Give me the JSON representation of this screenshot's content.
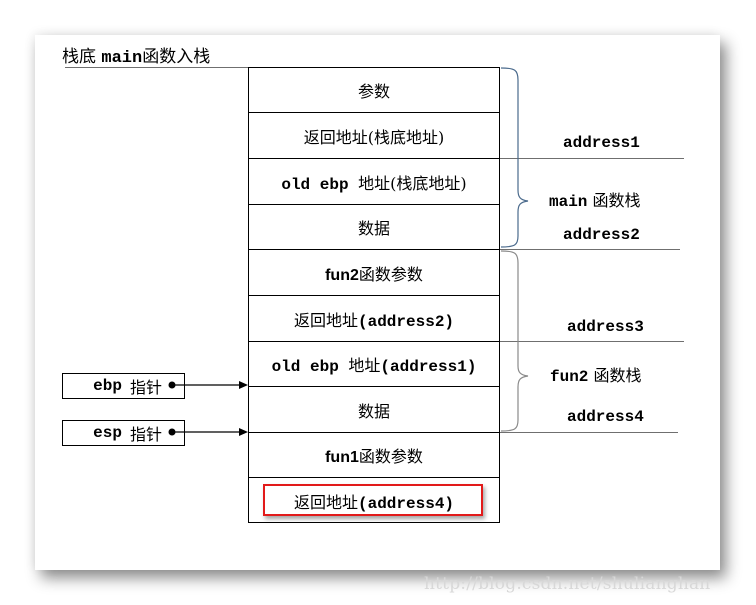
{
  "title": {
    "prefix": "栈底 ",
    "code": "main",
    "suffix": "函数入栈"
  },
  "stack_rows": [
    {
      "text": "参数",
      "code": ""
    },
    {
      "text": "返回地址(栈底地址)",
      "code": ""
    },
    {
      "code_prefix": "old ebp ",
      "text": "地址(栈底地址)"
    },
    {
      "text": "数据",
      "code": ""
    },
    {
      "code_prefix": "fun2",
      "text": "函数参数"
    },
    {
      "text": "返回地址",
      "code_suffix": "(address2)"
    },
    {
      "code_prefix": "old ebp ",
      "text": "地址",
      "code_suffix": "(address1)"
    },
    {
      "text": "数据",
      "code": ""
    },
    {
      "code_prefix": "fun1",
      "text": "函数参数"
    },
    {
      "text": "返回地址",
      "code_suffix": "(address4)",
      "highlighted": true
    }
  ],
  "addresses": [
    {
      "label": "address1"
    },
    {
      "label": "address2"
    },
    {
      "label": "address3"
    },
    {
      "label": "address4"
    }
  ],
  "braces": [
    {
      "code": "main",
      "text": " 函数栈",
      "color": "#4a6a8c"
    },
    {
      "code": "fun2",
      "text": " 函数栈",
      "color": "#8a8a8a"
    }
  ],
  "pointers": [
    {
      "code": "ebp",
      "text": "指针",
      "points_to": "old ebp 地址(address1) / 数据 boundary"
    },
    {
      "code": "esp",
      "text": "指针",
      "points_to": "数据 / fun1函数参数 boundary"
    }
  ],
  "highlight_color": "#e21a1a",
  "watermark": "http://blog.csdn.net/shulianghan"
}
